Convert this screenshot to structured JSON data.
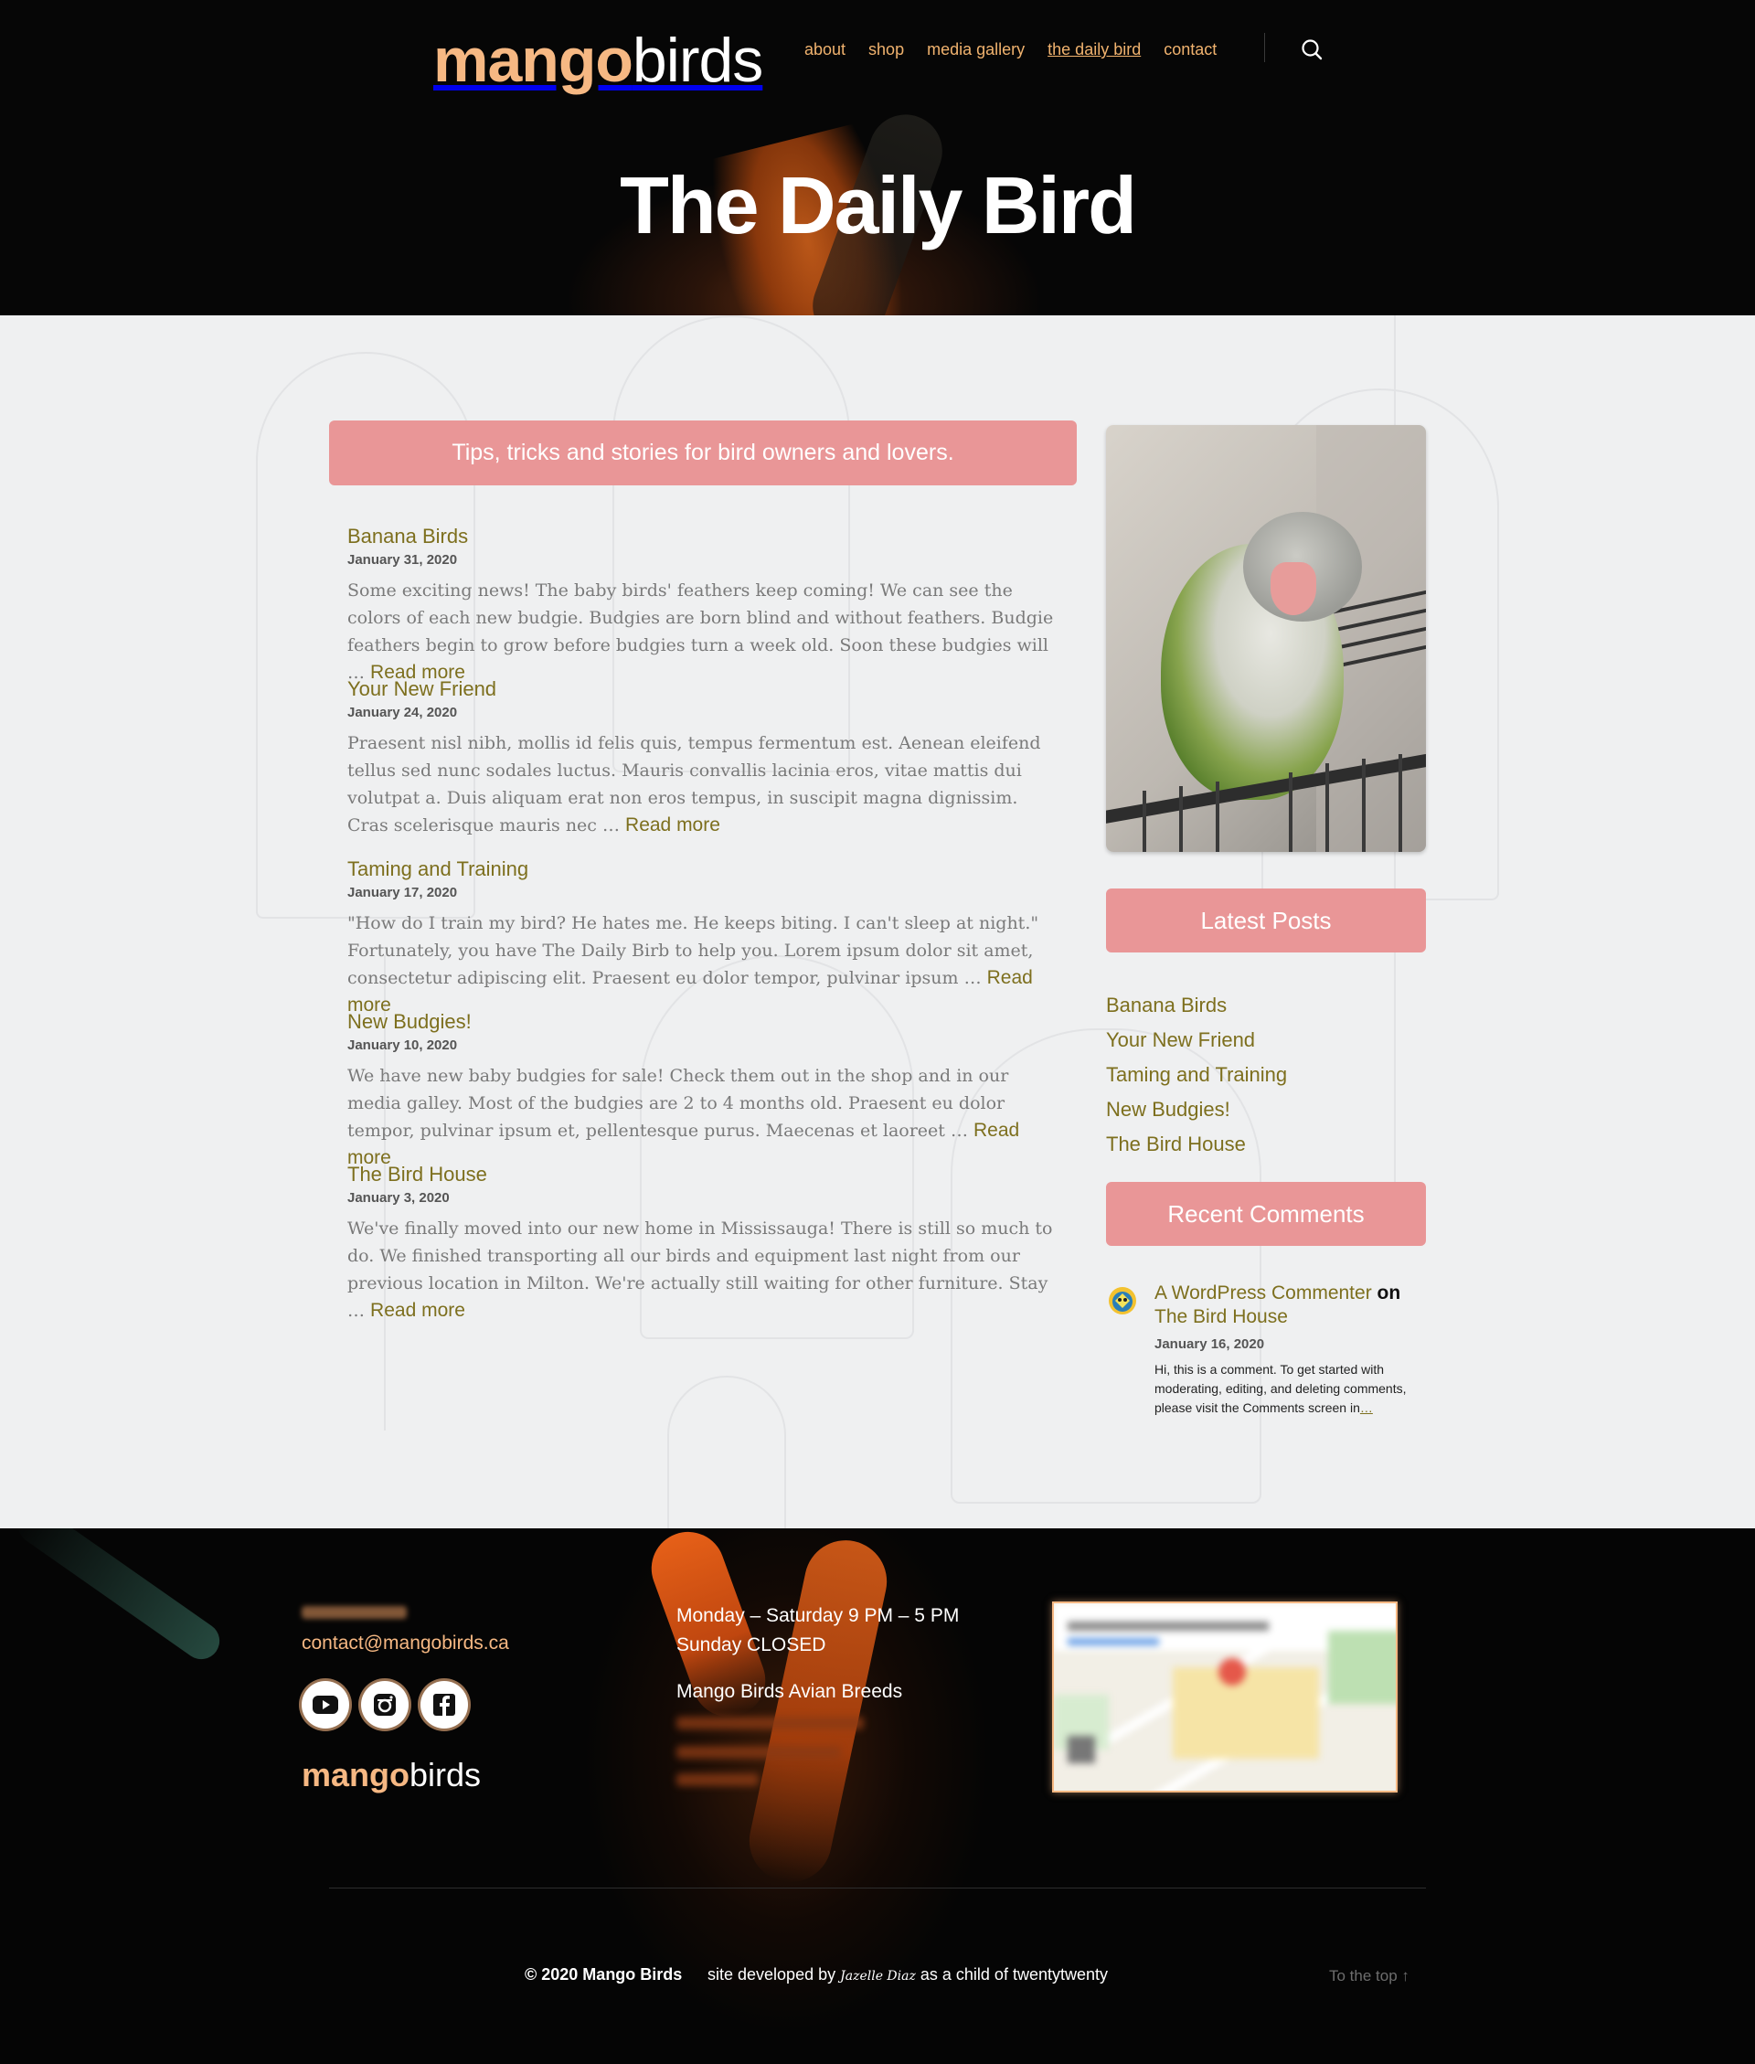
{
  "header": {
    "logo": {
      "part1": "mango",
      "part2": "birds"
    },
    "nav": [
      {
        "label": "about"
      },
      {
        "label": "shop"
      },
      {
        "label": "media gallery"
      },
      {
        "label": "the daily bird",
        "current": true
      },
      {
        "label": "contact"
      }
    ],
    "search_icon": "search-icon",
    "page_title": "The Daily Bird"
  },
  "main": {
    "tagline": "Tips, tricks and stories for bird owners and lovers.",
    "read_more_label": "Read more",
    "posts": [
      {
        "title": "Banana Birds",
        "date": "January 31, 2020",
        "excerpt": "Some exciting news! The baby birds' feathers keep coming! We can see the colors of each new budgie. Budgies are born blind and without feathers. Budgie feathers begin to grow before budgies turn a week old. Soon these budgies will …"
      },
      {
        "title": "Your New Friend",
        "date": "January 24, 2020",
        "excerpt": "Praesent nisl nibh, mollis id felis quis, tempus fermentum est. Aenean eleifend tellus sed nunc sodales luctus. Mauris convallis lacinia eros, vitae mattis dui volutpat a. Duis aliquam erat non eros tempus, in suscipit magna dignissim. Cras scelerisque mauris nec …"
      },
      {
        "title": "Taming and Training",
        "date": "January 17, 2020",
        "excerpt": "\"How do I train my bird? He hates me. He keeps biting. I can't sleep at night.\" Fortunately, you have The Daily Birb to help you. Lorem ipsum dolor sit amet, consectetur adipiscing elit. Praesent eu dolor tempor, pulvinar ipsum …"
      },
      {
        "title": "New Budgies!",
        "date": "January 10, 2020",
        "excerpt": "We have new baby budgies for sale! Check them out in the shop and in our media galley. Most of the budgies are 2 to 4 months old. Praesent eu dolor tempor, pulvinar ipsum et, pellentesque purus. Maecenas et laoreet …"
      },
      {
        "title": "The Bird House",
        "date": "January 3, 2020",
        "excerpt": "We've finally moved into our new home in Mississauga! There is still so much to do. We finished transporting all our birds and equipment last night from our previous location in Milton. We're actually still waiting for other furniture. Stay …"
      }
    ]
  },
  "sidebar": {
    "latest_posts_title": "Latest Posts",
    "latest_posts": [
      "Banana Birds",
      "Your New Friend",
      "Taming and Training",
      "New Budgies!",
      "The Bird House"
    ],
    "recent_comments_title": "Recent Comments",
    "comment": {
      "author": "A WordPress Commenter",
      "on": "on",
      "post": "The Bird House",
      "date": "January 16, 2020",
      "text": "Hi, this is a comment. To get started with moderating, editing, and deleting comments, please visit the Comments screen in",
      "ellipsis": "…"
    }
  },
  "footer": {
    "email": "contact@mangobirds.ca",
    "social": [
      {
        "icon": "youtube-icon"
      },
      {
        "icon": "instagram-icon"
      },
      {
        "icon": "facebook-icon"
      }
    ],
    "logo": {
      "part1": "mango",
      "part2": "birds"
    },
    "hours": [
      "Monday – Saturday 9 PM – 5 PM",
      "Sunday CLOSED"
    ],
    "business_name": "Mango Birds Avian Breeds",
    "copyright": "© 2020 Mango Birds",
    "credit_prefix": "site developed by",
    "credit_name": "Jazelle Diaz",
    "credit_suffix": "as a child of twentytwenty",
    "to_top": "To the top ↑"
  },
  "colors": {
    "accent_pink": "#e99697",
    "link_olive": "#7d6f1e",
    "logo_orange": "#f6b883",
    "nav_orange": "#f0b26e"
  }
}
